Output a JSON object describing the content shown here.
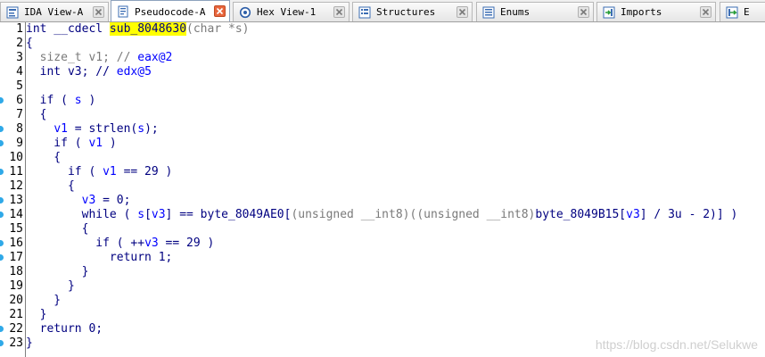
{
  "tabs": [
    {
      "label": "IDA View-A",
      "icon": "ida-view-icon",
      "active": false
    },
    {
      "label": "Pseudocode-A",
      "icon": "pseudocode-icon",
      "active": true
    },
    {
      "label": "Hex View-1",
      "icon": "hex-view-icon",
      "active": false
    },
    {
      "label": "Structures",
      "icon": "structures-icon",
      "active": false
    },
    {
      "label": "Enums",
      "icon": "enums-icon",
      "active": false
    },
    {
      "label": "Imports",
      "icon": "imports-icon",
      "active": false
    },
    {
      "label": "E",
      "icon": "exports-icon",
      "active": false
    }
  ],
  "colors": {
    "code_text": "#000080",
    "local_var": "#0000ff",
    "highlight": "#ffff00",
    "breakpoint_dot": "#2fa9e8",
    "active_close": "#e8663d"
  },
  "code_lines": [
    {
      "n": "1",
      "bp": false,
      "tokens": [
        {
          "t": "int __cdecl ",
          "c": "kw"
        },
        {
          "t": "sub_8048630",
          "c": "hl"
        },
        {
          "t": "(char *",
          "c": "gray"
        },
        {
          "t": "s",
          "c": "gray"
        },
        {
          "t": ")",
          "c": "gray"
        }
      ]
    },
    {
      "n": "2",
      "bp": false,
      "tokens": [
        {
          "t": "{",
          "c": "kw"
        }
      ]
    },
    {
      "n": "3",
      "bp": false,
      "tokens": [
        {
          "t": "  size_t ",
          "c": "gray"
        },
        {
          "t": "v1",
          "c": "gray"
        },
        {
          "t": "; // ",
          "c": "gray"
        },
        {
          "t": "eax@2",
          "c": "lv"
        }
      ]
    },
    {
      "n": "4",
      "bp": false,
      "tokens": [
        {
          "t": "  int ",
          "c": "kw"
        },
        {
          "t": "v3",
          "c": "kw"
        },
        {
          "t": "; // ",
          "c": "kw"
        },
        {
          "t": "edx@5",
          "c": "lv"
        }
      ]
    },
    {
      "n": "5",
      "bp": false,
      "tokens": [
        {
          "t": "",
          "c": "kw"
        }
      ]
    },
    {
      "n": "6",
      "bp": true,
      "tokens": [
        {
          "t": "  if ( ",
          "c": "kw"
        },
        {
          "t": "s",
          "c": "lv"
        },
        {
          "t": " )",
          "c": "kw"
        }
      ]
    },
    {
      "n": "7",
      "bp": false,
      "tokens": [
        {
          "t": "  {",
          "c": "kw"
        }
      ]
    },
    {
      "n": "8",
      "bp": true,
      "tokens": [
        {
          "t": "    ",
          "c": "kw"
        },
        {
          "t": "v1",
          "c": "lv"
        },
        {
          "t": " = strlen(",
          "c": "kw"
        },
        {
          "t": "s",
          "c": "lv"
        },
        {
          "t": ");",
          "c": "kw"
        }
      ]
    },
    {
      "n": "9",
      "bp": true,
      "tokens": [
        {
          "t": "    if ( ",
          "c": "kw"
        },
        {
          "t": "v1",
          "c": "lv"
        },
        {
          "t": " )",
          "c": "kw"
        }
      ]
    },
    {
      "n": "10",
      "bp": false,
      "tokens": [
        {
          "t": "    {",
          "c": "kw"
        }
      ]
    },
    {
      "n": "11",
      "bp": true,
      "tokens": [
        {
          "t": "      if ( ",
          "c": "kw"
        },
        {
          "t": "v1",
          "c": "lv"
        },
        {
          "t": " == 29 )",
          "c": "kw"
        }
      ]
    },
    {
      "n": "12",
      "bp": false,
      "tokens": [
        {
          "t": "      {",
          "c": "kw"
        }
      ]
    },
    {
      "n": "13",
      "bp": true,
      "tokens": [
        {
          "t": "        ",
          "c": "kw"
        },
        {
          "t": "v3",
          "c": "lv"
        },
        {
          "t": " = 0;",
          "c": "kw"
        }
      ]
    },
    {
      "n": "14",
      "bp": true,
      "tokens": [
        {
          "t": "        while ( ",
          "c": "kw"
        },
        {
          "t": "s",
          "c": "lv"
        },
        {
          "t": "[",
          "c": "kw"
        },
        {
          "t": "v3",
          "c": "lv"
        },
        {
          "t": "] == byte_8049AE0[",
          "c": "kw"
        },
        {
          "t": "(unsigned __int8)((unsigned __int8)",
          "c": "gray"
        },
        {
          "t": "byte_8049B15[",
          "c": "kw"
        },
        {
          "t": "v3",
          "c": "lv"
        },
        {
          "t": "] / 3u - 2)] )",
          "c": "kw"
        }
      ]
    },
    {
      "n": "15",
      "bp": false,
      "tokens": [
        {
          "t": "        {",
          "c": "kw"
        }
      ]
    },
    {
      "n": "16",
      "bp": true,
      "tokens": [
        {
          "t": "          if ( ++",
          "c": "kw"
        },
        {
          "t": "v3",
          "c": "lv"
        },
        {
          "t": " == 29 )",
          "c": "kw"
        }
      ]
    },
    {
      "n": "17",
      "bp": true,
      "tokens": [
        {
          "t": "            return 1;",
          "c": "kw"
        }
      ]
    },
    {
      "n": "18",
      "bp": false,
      "tokens": [
        {
          "t": "        }",
          "c": "kw"
        }
      ]
    },
    {
      "n": "19",
      "bp": false,
      "tokens": [
        {
          "t": "      }",
          "c": "kw"
        }
      ]
    },
    {
      "n": "20",
      "bp": false,
      "tokens": [
        {
          "t": "    }",
          "c": "kw"
        }
      ]
    },
    {
      "n": "21",
      "bp": false,
      "tokens": [
        {
          "t": "  }",
          "c": "kw"
        }
      ]
    },
    {
      "n": "22",
      "bp": true,
      "tokens": [
        {
          "t": "  return 0;",
          "c": "kw"
        }
      ]
    },
    {
      "n": "23",
      "bp": true,
      "tokens": [
        {
          "t": "}",
          "c": "kw"
        }
      ]
    }
  ],
  "watermark": "https://blog.csdn.net/Selukwe"
}
